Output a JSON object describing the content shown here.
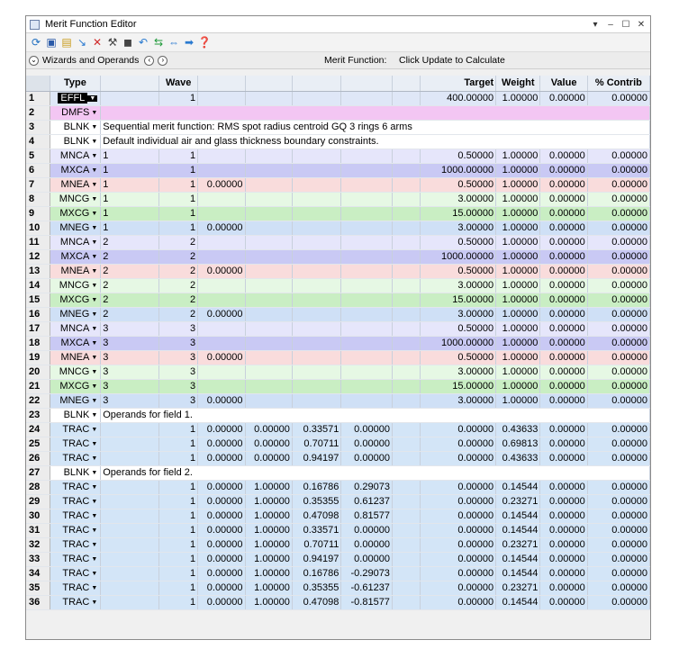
{
  "window": {
    "title": "Merit Function Editor",
    "controls": [
      "▾",
      "–",
      "☐",
      "✕"
    ]
  },
  "toolbar": {
    "icons": [
      "refresh-icon",
      "save-icon",
      "load-icon",
      "insert-icon",
      "delete-icon",
      "wizard-icon",
      "stop-icon",
      "undo-icon",
      "forward-icon",
      "fit-icon",
      "arrow-icon",
      "help-icon"
    ]
  },
  "wizbar": {
    "label": "Wizards and Operands",
    "merit_label": "Merit Function:",
    "merit_value": "Click Update to Calculate"
  },
  "columns": [
    "",
    "Type",
    "",
    "Wave",
    "",
    "",
    "",
    "",
    "",
    "Target",
    "Weight",
    "Value",
    "% Contrib"
  ],
  "rows": [
    {
      "n": "1",
      "type": "EFFL",
      "cls": "effl",
      "sel": true,
      "c1": "",
      "wave": "1",
      "c3": "",
      "c4": "",
      "c5": "",
      "c6": "",
      "target": "400.00000",
      "weight": "1.00000",
      "value": "0.00000",
      "contrib": "0.00000"
    },
    {
      "n": "2",
      "type": "DMFS",
      "cls": "dmfs",
      "text": ""
    },
    {
      "n": "3",
      "type": "BLNK",
      "cls": "blnk",
      "text": "Sequential merit function: RMS spot radius centroid GQ 3 rings 6 arms"
    },
    {
      "n": "4",
      "type": "BLNK",
      "cls": "blnk",
      "text": "Default individual air and glass thickness boundary constraints."
    },
    {
      "n": "5",
      "type": "MNCA",
      "cls": "nca",
      "c1": "1",
      "wave": "1",
      "c3": "",
      "c4": "",
      "c5": "",
      "c6": "",
      "target": "0.50000",
      "weight": "1.00000",
      "value": "0.00000",
      "contrib": "0.00000"
    },
    {
      "n": "6",
      "type": "MXCA",
      "cls": "xca",
      "c1": "1",
      "wave": "1",
      "c3": "",
      "c4": "",
      "c5": "",
      "c6": "",
      "target": "1000.00000",
      "weight": "1.00000",
      "value": "0.00000",
      "contrib": "0.00000"
    },
    {
      "n": "7",
      "type": "MNEA",
      "cls": "nea",
      "c1": "1",
      "wave": "1",
      "c3": "0.00000",
      "c4": "",
      "c5": "",
      "c6": "",
      "target": "0.50000",
      "weight": "1.00000",
      "value": "0.00000",
      "contrib": "0.00000"
    },
    {
      "n": "8",
      "type": "MNCG",
      "cls": "ncg",
      "c1": "1",
      "wave": "1",
      "c3": "",
      "c4": "",
      "c5": "",
      "c6": "",
      "target": "3.00000",
      "weight": "1.00000",
      "value": "0.00000",
      "contrib": "0.00000"
    },
    {
      "n": "9",
      "type": "MXCG",
      "cls": "xcg",
      "c1": "1",
      "wave": "1",
      "c3": "",
      "c4": "",
      "c5": "",
      "c6": "",
      "target": "15.00000",
      "weight": "1.00000",
      "value": "0.00000",
      "contrib": "0.00000"
    },
    {
      "n": "10",
      "type": "MNEG",
      "cls": "neg",
      "c1": "1",
      "wave": "1",
      "c3": "0.00000",
      "c4": "",
      "c5": "",
      "c6": "",
      "target": "3.00000",
      "weight": "1.00000",
      "value": "0.00000",
      "contrib": "0.00000"
    },
    {
      "n": "11",
      "type": "MNCA",
      "cls": "nca",
      "c1": "2",
      "wave": "2",
      "c3": "",
      "c4": "",
      "c5": "",
      "c6": "",
      "target": "0.50000",
      "weight": "1.00000",
      "value": "0.00000",
      "contrib": "0.00000"
    },
    {
      "n": "12",
      "type": "MXCA",
      "cls": "xca",
      "c1": "2",
      "wave": "2",
      "c3": "",
      "c4": "",
      "c5": "",
      "c6": "",
      "target": "1000.00000",
      "weight": "1.00000",
      "value": "0.00000",
      "contrib": "0.00000"
    },
    {
      "n": "13",
      "type": "MNEA",
      "cls": "nea",
      "c1": "2",
      "wave": "2",
      "c3": "0.00000",
      "c4": "",
      "c5": "",
      "c6": "",
      "target": "0.50000",
      "weight": "1.00000",
      "value": "0.00000",
      "contrib": "0.00000"
    },
    {
      "n": "14",
      "type": "MNCG",
      "cls": "ncg",
      "c1": "2",
      "wave": "2",
      "c3": "",
      "c4": "",
      "c5": "",
      "c6": "",
      "target": "3.00000",
      "weight": "1.00000",
      "value": "0.00000",
      "contrib": "0.00000"
    },
    {
      "n": "15",
      "type": "MXCG",
      "cls": "xcg",
      "c1": "2",
      "wave": "2",
      "c3": "",
      "c4": "",
      "c5": "",
      "c6": "",
      "target": "15.00000",
      "weight": "1.00000",
      "value": "0.00000",
      "contrib": "0.00000"
    },
    {
      "n": "16",
      "type": "MNEG",
      "cls": "neg",
      "c1": "2",
      "wave": "2",
      "c3": "0.00000",
      "c4": "",
      "c5": "",
      "c6": "",
      "target": "3.00000",
      "weight": "1.00000",
      "value": "0.00000",
      "contrib": "0.00000"
    },
    {
      "n": "17",
      "type": "MNCA",
      "cls": "nca",
      "c1": "3",
      "wave": "3",
      "c3": "",
      "c4": "",
      "c5": "",
      "c6": "",
      "target": "0.50000",
      "weight": "1.00000",
      "value": "0.00000",
      "contrib": "0.00000"
    },
    {
      "n": "18",
      "type": "MXCA",
      "cls": "xca",
      "c1": "3",
      "wave": "3",
      "c3": "",
      "c4": "",
      "c5": "",
      "c6": "",
      "target": "1000.00000",
      "weight": "1.00000",
      "value": "0.00000",
      "contrib": "0.00000"
    },
    {
      "n": "19",
      "type": "MNEA",
      "cls": "nea",
      "c1": "3",
      "wave": "3",
      "c3": "0.00000",
      "c4": "",
      "c5": "",
      "c6": "",
      "target": "0.50000",
      "weight": "1.00000",
      "value": "0.00000",
      "contrib": "0.00000"
    },
    {
      "n": "20",
      "type": "MNCG",
      "cls": "ncg",
      "c1": "3",
      "wave": "3",
      "c3": "",
      "c4": "",
      "c5": "",
      "c6": "",
      "target": "3.00000",
      "weight": "1.00000",
      "value": "0.00000",
      "contrib": "0.00000"
    },
    {
      "n": "21",
      "type": "MXCG",
      "cls": "xcg",
      "c1": "3",
      "wave": "3",
      "c3": "",
      "c4": "",
      "c5": "",
      "c6": "",
      "target": "15.00000",
      "weight": "1.00000",
      "value": "0.00000",
      "contrib": "0.00000"
    },
    {
      "n": "22",
      "type": "MNEG",
      "cls": "neg",
      "c1": "3",
      "wave": "3",
      "c3": "0.00000",
      "c4": "",
      "c5": "",
      "c6": "",
      "target": "3.00000",
      "weight": "1.00000",
      "value": "0.00000",
      "contrib": "0.00000"
    },
    {
      "n": "23",
      "type": "BLNK",
      "cls": "blnk",
      "text": "Operands for field 1."
    },
    {
      "n": "24",
      "type": "TRAC",
      "cls": "trac",
      "c1": "",
      "wave": "1",
      "c3": "0.00000",
      "c4": "0.00000",
      "c5": "0.33571",
      "c6": "0.00000",
      "target": "0.00000",
      "weight": "0.43633",
      "value": "0.00000",
      "contrib": "0.00000"
    },
    {
      "n": "25",
      "type": "TRAC",
      "cls": "trac",
      "c1": "",
      "wave": "1",
      "c3": "0.00000",
      "c4": "0.00000",
      "c5": "0.70711",
      "c6": "0.00000",
      "target": "0.00000",
      "weight": "0.69813",
      "value": "0.00000",
      "contrib": "0.00000"
    },
    {
      "n": "26",
      "type": "TRAC",
      "cls": "trac",
      "c1": "",
      "wave": "1",
      "c3": "0.00000",
      "c4": "0.00000",
      "c5": "0.94197",
      "c6": "0.00000",
      "target": "0.00000",
      "weight": "0.43633",
      "value": "0.00000",
      "contrib": "0.00000"
    },
    {
      "n": "27",
      "type": "BLNK",
      "cls": "blnk",
      "text": "Operands for field 2."
    },
    {
      "n": "28",
      "type": "TRAC",
      "cls": "trac",
      "c1": "",
      "wave": "1",
      "c3": "0.00000",
      "c4": "1.00000",
      "c5": "0.16786",
      "c6": "0.29073",
      "target": "0.00000",
      "weight": "0.14544",
      "value": "0.00000",
      "contrib": "0.00000"
    },
    {
      "n": "29",
      "type": "TRAC",
      "cls": "trac",
      "c1": "",
      "wave": "1",
      "c3": "0.00000",
      "c4": "1.00000",
      "c5": "0.35355",
      "c6": "0.61237",
      "target": "0.00000",
      "weight": "0.23271",
      "value": "0.00000",
      "contrib": "0.00000"
    },
    {
      "n": "30",
      "type": "TRAC",
      "cls": "trac",
      "c1": "",
      "wave": "1",
      "c3": "0.00000",
      "c4": "1.00000",
      "c5": "0.47098",
      "c6": "0.81577",
      "target": "0.00000",
      "weight": "0.14544",
      "value": "0.00000",
      "contrib": "0.00000"
    },
    {
      "n": "31",
      "type": "TRAC",
      "cls": "trac",
      "c1": "",
      "wave": "1",
      "c3": "0.00000",
      "c4": "1.00000",
      "c5": "0.33571",
      "c6": "0.00000",
      "target": "0.00000",
      "weight": "0.14544",
      "value": "0.00000",
      "contrib": "0.00000"
    },
    {
      "n": "32",
      "type": "TRAC",
      "cls": "trac",
      "c1": "",
      "wave": "1",
      "c3": "0.00000",
      "c4": "1.00000",
      "c5": "0.70711",
      "c6": "0.00000",
      "target": "0.00000",
      "weight": "0.23271",
      "value": "0.00000",
      "contrib": "0.00000"
    },
    {
      "n": "33",
      "type": "TRAC",
      "cls": "trac",
      "c1": "",
      "wave": "1",
      "c3": "0.00000",
      "c4": "1.00000",
      "c5": "0.94197",
      "c6": "0.00000",
      "target": "0.00000",
      "weight": "0.14544",
      "value": "0.00000",
      "contrib": "0.00000"
    },
    {
      "n": "34",
      "type": "TRAC",
      "cls": "trac",
      "c1": "",
      "wave": "1",
      "c3": "0.00000",
      "c4": "1.00000",
      "c5": "0.16786",
      "c6": "-0.29073",
      "target": "0.00000",
      "weight": "0.14544",
      "value": "0.00000",
      "contrib": "0.00000"
    },
    {
      "n": "35",
      "type": "TRAC",
      "cls": "trac",
      "c1": "",
      "wave": "1",
      "c3": "0.00000",
      "c4": "1.00000",
      "c5": "0.35355",
      "c6": "-0.61237",
      "target": "0.00000",
      "weight": "0.23271",
      "value": "0.00000",
      "contrib": "0.00000"
    },
    {
      "n": "36",
      "type": "TRAC",
      "cls": "trac",
      "c1": "",
      "wave": "1",
      "c3": "0.00000",
      "c4": "1.00000",
      "c5": "0.47098",
      "c6": "-0.81577",
      "target": "0.00000",
      "weight": "0.14544",
      "value": "0.00000",
      "contrib": "0.00000"
    }
  ]
}
